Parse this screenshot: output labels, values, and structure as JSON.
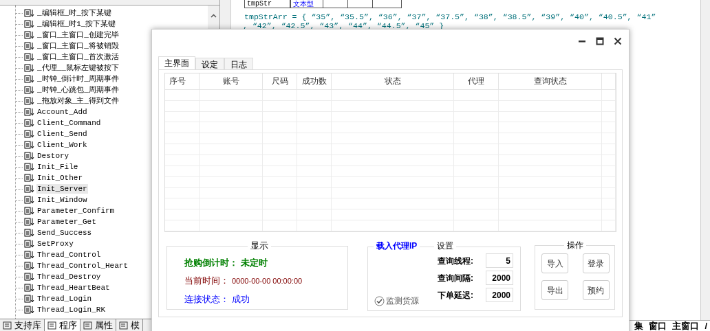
{
  "tree": {
    "items": [
      {
        "label": "_编辑框_时_按下某键",
        "selected": false
      },
      {
        "label": "_编辑框_时1_按下某键",
        "selected": false
      },
      {
        "label": "_窗口_主窗口_创建完毕",
        "selected": false
      },
      {
        "label": "_窗口_主窗口_将被销毁",
        "selected": false
      },
      {
        "label": "_窗口_主窗口_首次激活",
        "selected": false
      },
      {
        "label": "_代理__鼠标左键被按下",
        "selected": false
      },
      {
        "label": "_时钟_倒计时_周期事件",
        "selected": false
      },
      {
        "label": "_时钟_心跳包_周期事件",
        "selected": false
      },
      {
        "label": "_拖放对象_主_得到文件",
        "selected": false
      },
      {
        "label": "Account_Add",
        "selected": false
      },
      {
        "label": "Client_Command",
        "selected": false
      },
      {
        "label": "Client_Send",
        "selected": false
      },
      {
        "label": "Client_Work",
        "selected": false
      },
      {
        "label": "Destory",
        "selected": false
      },
      {
        "label": "Init_File",
        "selected": false
      },
      {
        "label": "Init_Other",
        "selected": false
      },
      {
        "label": "Init_Server",
        "selected": true
      },
      {
        "label": "Init_Window",
        "selected": false
      },
      {
        "label": "Parameter_Confirm",
        "selected": false
      },
      {
        "label": "Parameter_Get",
        "selected": false
      },
      {
        "label": "Send_Success",
        "selected": false
      },
      {
        "label": "SetProxy",
        "selected": false
      },
      {
        "label": "Thread_Control",
        "selected": false
      },
      {
        "label": "Thread_Control_Heart",
        "selected": false
      },
      {
        "label": "Thread_Destroy",
        "selected": false
      },
      {
        "label": "Thread_HeartBeat",
        "selected": false
      },
      {
        "label": "Thread_Login",
        "selected": false
      },
      {
        "label": "Thread_Login_RK",
        "selected": false
      }
    ]
  },
  "bottom_tabs": [
    {
      "label": "支持库",
      "selected": false
    },
    {
      "label": "程序",
      "selected": true
    },
    {
      "label": "属性",
      "selected": false
    },
    {
      "label": "模",
      "selected": false
    }
  ],
  "code": {
    "var_row": [
      "tmpStr",
      "文本型"
    ],
    "lines": [
      "tmpStrArr = { “35”, “35.5”, “36”, “37”, “37.5”, “38”, “38.5”, “39”, “40”, “40.5”, “41”",
      ", “42”, “42.5”, “43”, “44”, “44.5”, “45” }"
    ]
  },
  "editor_tabs": [
    "集",
    "窗口",
    "主窗口",
    "/"
  ],
  "dialog": {
    "tabs": [
      {
        "label": "主界面",
        "selected": true
      },
      {
        "label": "设定",
        "selected": false
      },
      {
        "label": "日志",
        "selected": false
      }
    ],
    "table": {
      "columns": [
        "序号",
        "账号",
        "尺码",
        "成功数",
        "状态",
        "代理",
        "查询状态"
      ]
    },
    "display": {
      "title": "显示",
      "countdown": "抢购倒计时： 未定时",
      "time_label": "当前时间：",
      "time_value": "0000-00-00 00:00:00",
      "status": "连接状态： 成功"
    },
    "settings": {
      "link": "载入代理IP",
      "title": "设置",
      "fields": [
        {
          "label": "查询线程:",
          "value": "5"
        },
        {
          "label": "查询间隔:",
          "value": "2000"
        },
        {
          "label": "下单延迟:",
          "value": "2000"
        }
      ],
      "monitor": {
        "label": "监测货源",
        "checked": true
      }
    },
    "actions": {
      "title": "操作",
      "buttons": [
        "导入",
        "登录",
        "导出",
        "预约"
      ]
    }
  }
}
